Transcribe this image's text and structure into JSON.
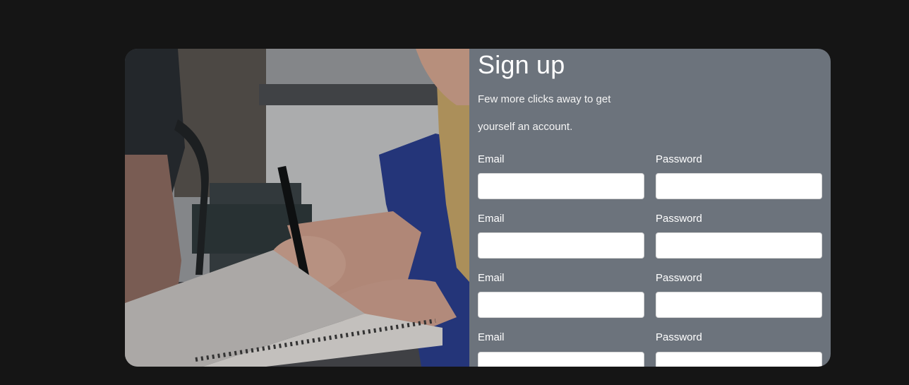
{
  "signup": {
    "title": "Sign up",
    "subtitle": "Few more clicks away to get yourself an account.",
    "rows": [
      {
        "email_label": "Email",
        "email_value": "",
        "password_label": "Password",
        "password_value": ""
      },
      {
        "email_label": "Email",
        "email_value": "",
        "password_label": "Password",
        "password_value": ""
      },
      {
        "email_label": "Email",
        "email_value": "",
        "password_label": "Password",
        "password_value": ""
      },
      {
        "email_label": "Email",
        "email_value": "",
        "password_label": "Password",
        "password_value": ""
      }
    ]
  },
  "colors": {
    "page_background": "#151515",
    "panel_background": "#6c737c",
    "text": "#ffffff",
    "input_background": "#ffffff"
  },
  "image": {
    "description_icon": "photo-person-writing-in-notebook"
  }
}
